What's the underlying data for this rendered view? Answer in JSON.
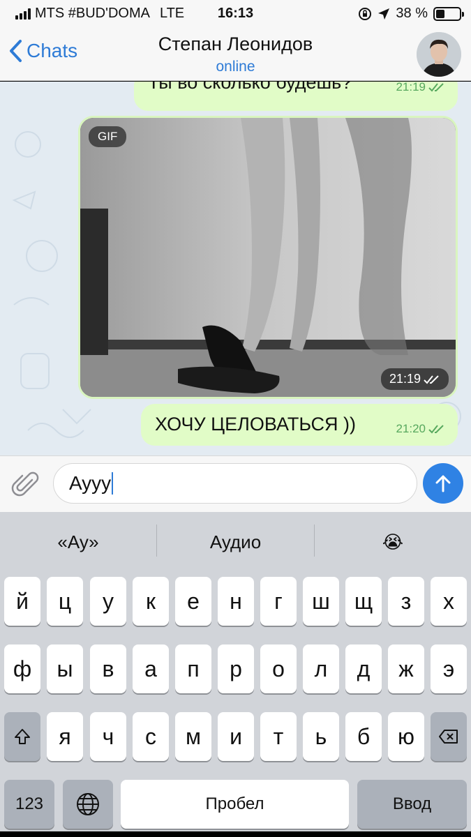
{
  "status_bar": {
    "carrier": "MTS #BUD'DOMA",
    "network": "LTE",
    "time": "16:13",
    "battery_percent": "38 %",
    "battery_level": 0.38
  },
  "header": {
    "back_label": "Chats",
    "contact_name": "Степан Леонидов",
    "contact_status": "online"
  },
  "messages": [
    {
      "text": "Ты во сколько будешь?",
      "time": "21:19"
    },
    {
      "badge": "GIF",
      "time": "21:19"
    },
    {
      "text": "ХОЧУ ЦЕЛОВАТЬСЯ ))",
      "time": "21:20"
    }
  ],
  "input": {
    "value": "Ayyy"
  },
  "keyboard": {
    "suggestions": [
      "«Ау»",
      "Аудио",
      "😭"
    ],
    "row1": [
      "й",
      "ц",
      "у",
      "к",
      "е",
      "н",
      "г",
      "ш",
      "щ",
      "з",
      "х"
    ],
    "row2": [
      "ф",
      "ы",
      "в",
      "а",
      "п",
      "р",
      "о",
      "л",
      "д",
      "ж",
      "э"
    ],
    "row3": [
      "я",
      "ч",
      "с",
      "м",
      "и",
      "т",
      "ь",
      "б",
      "ю"
    ],
    "numbers_label": "123",
    "space_label": "Пробел",
    "return_label": "Ввод"
  },
  "colors": {
    "accent": "#2e7bd6",
    "outgoing_bubble": "#e1fcc7",
    "check_green": "#57a85e"
  }
}
